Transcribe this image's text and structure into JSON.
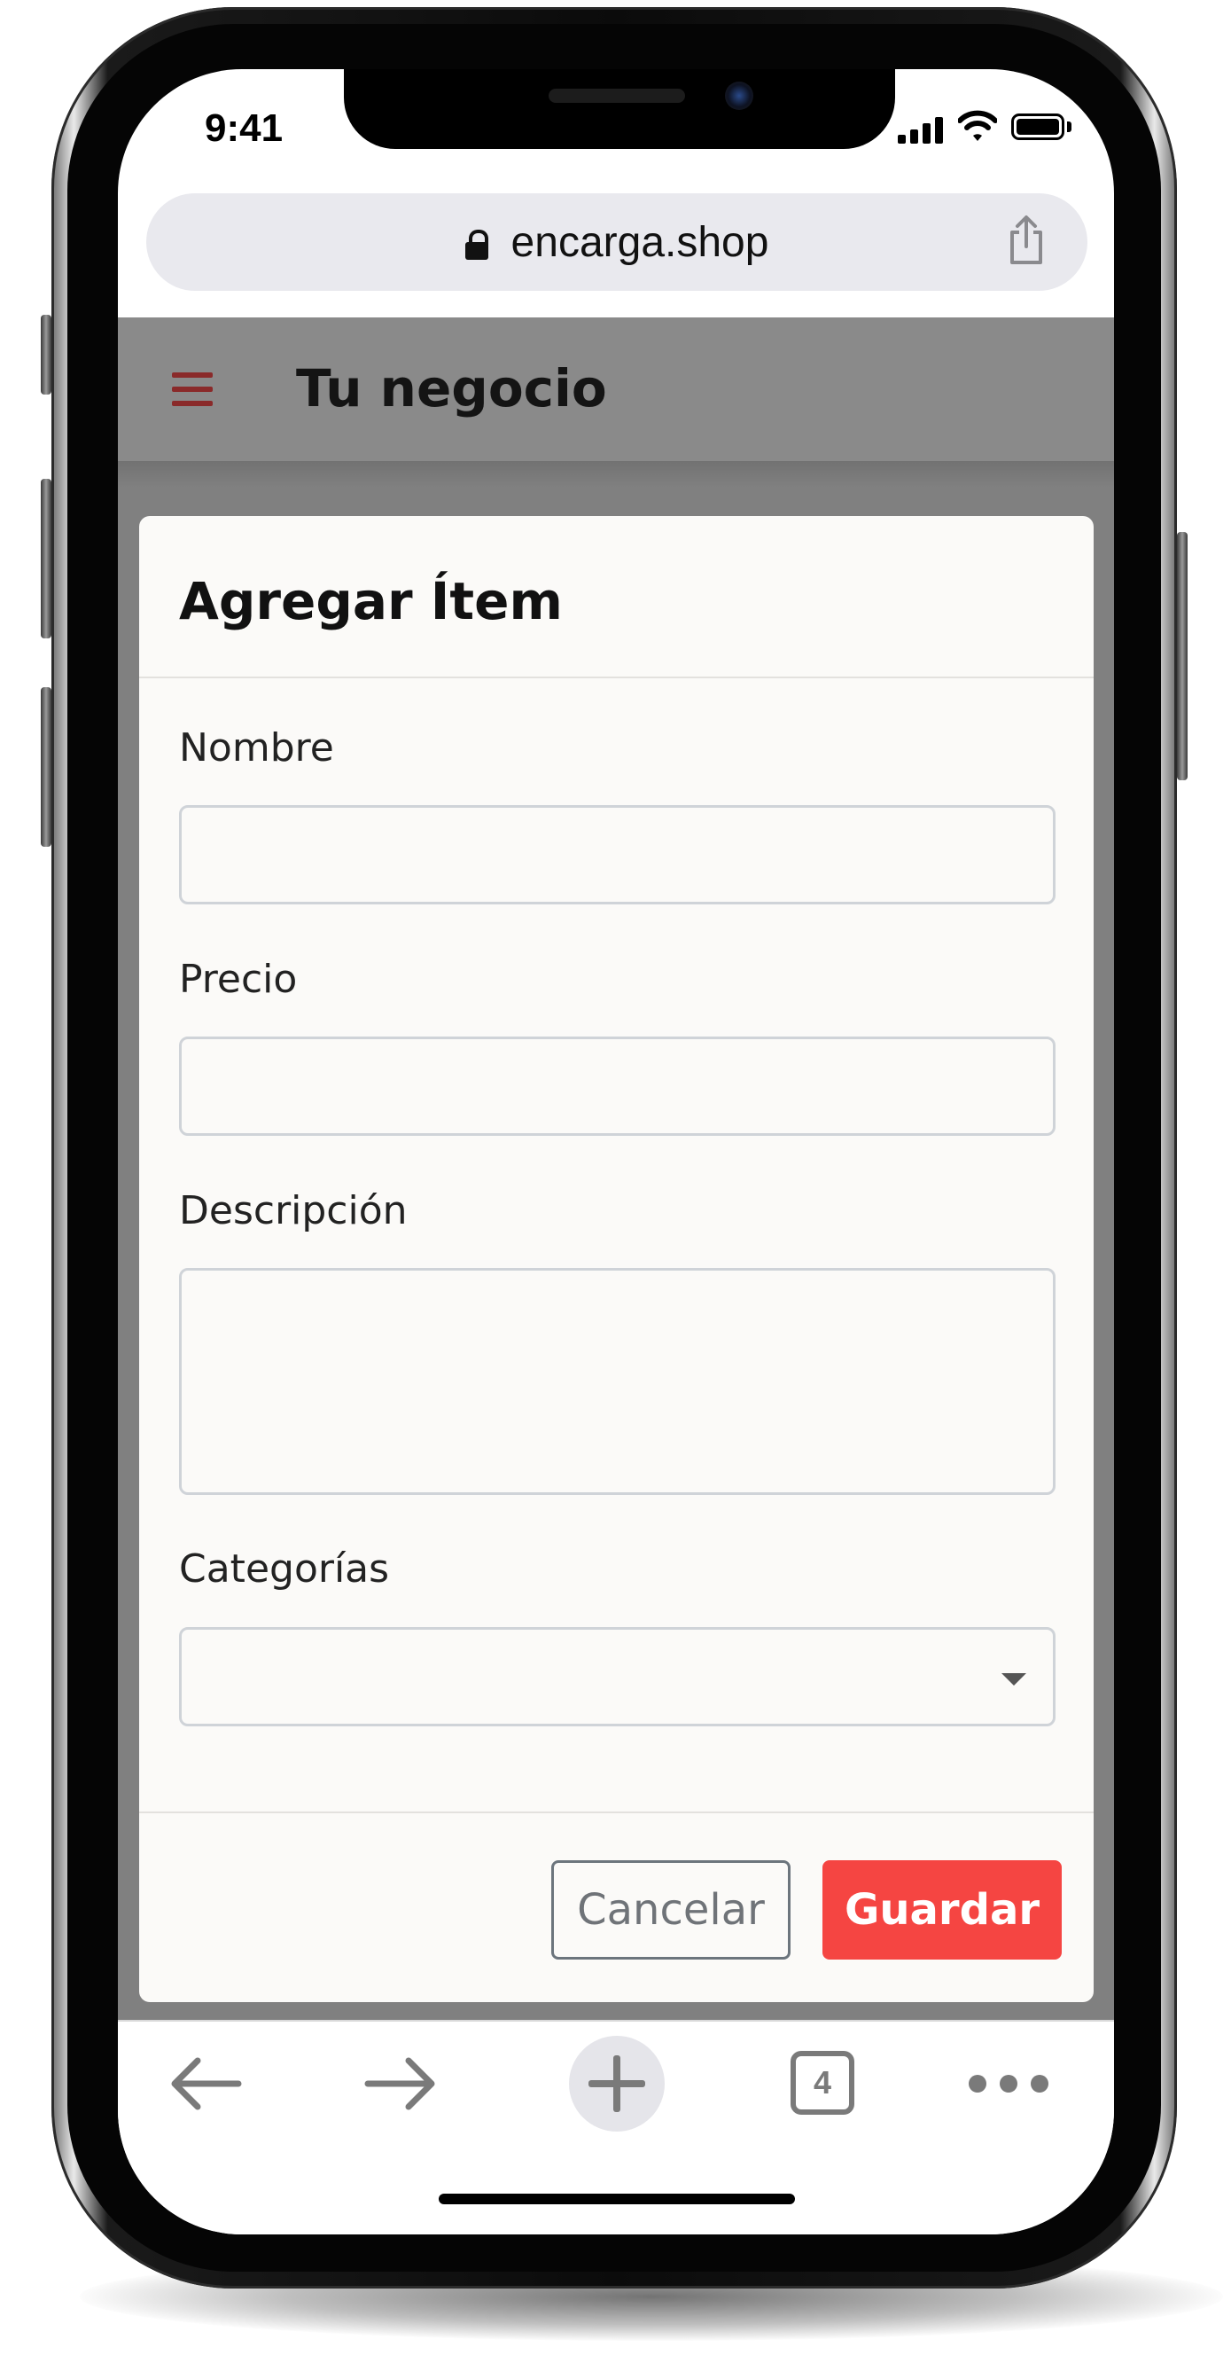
{
  "status_bar": {
    "time": "9:41"
  },
  "browser": {
    "url": "encarga.shop",
    "tabs_count": "4"
  },
  "app": {
    "title": "Tu negocio",
    "accent_color": "#8a2a2a"
  },
  "modal": {
    "title": "Agregar Ítem",
    "fields": {
      "name": {
        "label": "Nombre",
        "value": ""
      },
      "price": {
        "label": "Precio",
        "value": ""
      },
      "description": {
        "label": "Descripción",
        "value": ""
      },
      "categories": {
        "label": "Categorías",
        "value": ""
      }
    },
    "buttons": {
      "cancel": "Cancelar",
      "save": "Guardar",
      "save_color": "#f54542"
    }
  },
  "toolbar": {
    "icons": [
      "back-arrow-icon",
      "forward-arrow-icon",
      "new-tab-plus-icon",
      "tabs-icon",
      "more-icon"
    ]
  }
}
